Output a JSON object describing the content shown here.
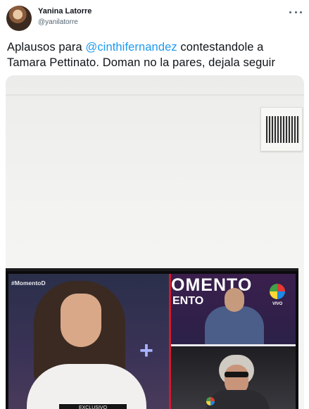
{
  "author": {
    "name": "Yanina Latorre",
    "handle": "@yanilatorre"
  },
  "tweet": {
    "text_before_mention": "Aplausos para ",
    "mention": "@cinthifernandez",
    "text_after_mention": " contestandole a Tamara Pettinato. Doman no la pares, dejala seguir"
  },
  "media": {
    "hashtag": "#MomentoD",
    "show_title_line1": "OMENTO",
    "show_title_line2": "ENTO",
    "live_label": "VIVO",
    "lower_third": "EXCLUSIVO"
  },
  "icons": {
    "more": "more-horizontal-icon",
    "channel_logo": "channel-logo-icon"
  }
}
